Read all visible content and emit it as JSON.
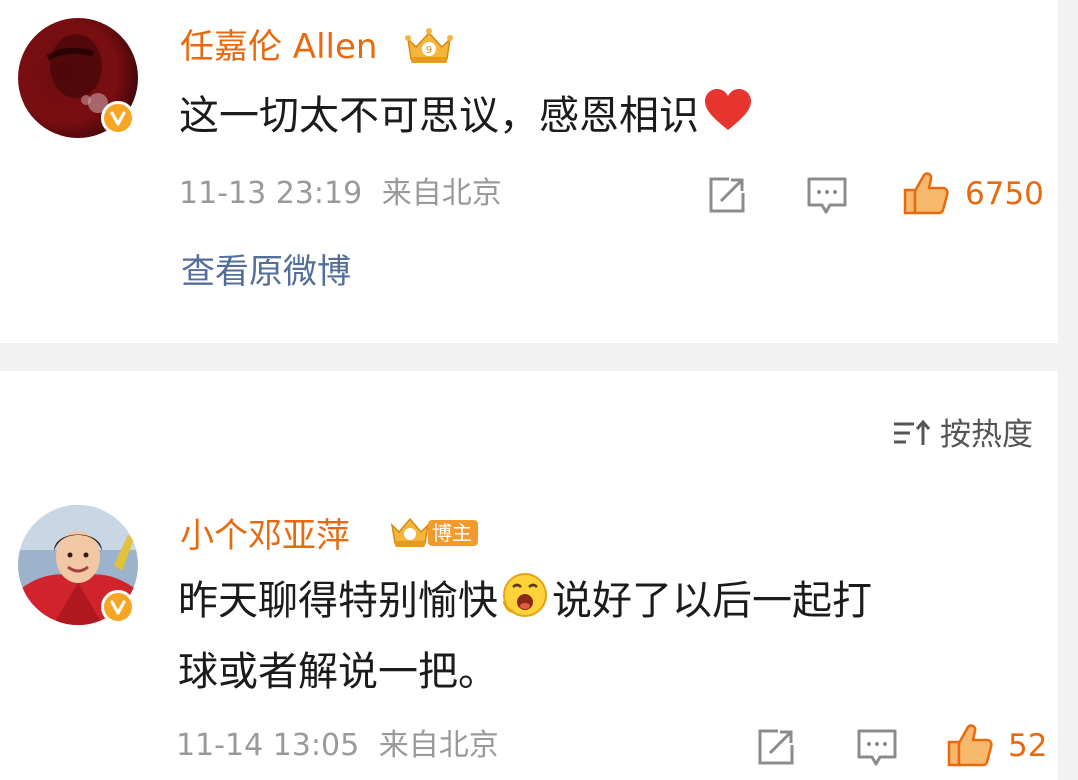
{
  "comments": [
    {
      "username": "任嘉伦 Allen",
      "text": "这一切太不可思议，感恩相识",
      "time": "11-13 23:19",
      "location": "来自北京",
      "likes": "6750",
      "view_original": "查看原微博"
    },
    {
      "username": "小个邓亚萍",
      "badge": "博主",
      "text_line1": "昨天聊得特别愉快",
      "text_line1b": "说好了以后一起打",
      "text_line2": "球或者解说一把。",
      "time": "11-14 13:05",
      "location": "来自北京",
      "likes": "52"
    }
  ],
  "sort": {
    "label": "按热度"
  },
  "colors": {
    "username": "#e86a10",
    "link": "#536e98",
    "meta": "#9a9a9a",
    "verified_badge": "#f6a623"
  }
}
